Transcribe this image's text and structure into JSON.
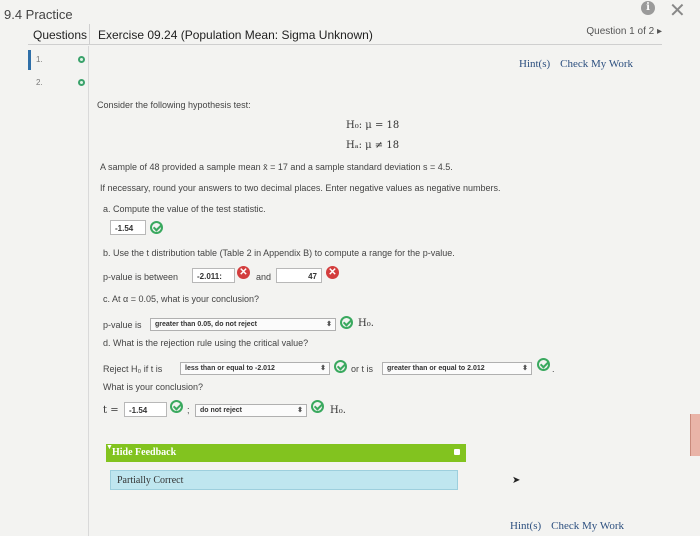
{
  "app": {
    "title": "9.4 Practice"
  },
  "header": {
    "questions_tab": "Questions",
    "exercise_title": "Exercise 09.24 (Population Mean: Sigma Unknown)",
    "counter": "Question 1 of 2 ▸"
  },
  "question_list": [
    {
      "number": "1.",
      "status": "answered"
    },
    {
      "number": "2.",
      "status": "answered"
    }
  ],
  "links": {
    "hints": "Hint(s)",
    "check": "Check My Work"
  },
  "problem": {
    "intro": "Consider the following hypothesis test:",
    "h0": "H₀: μ = 18",
    "ha": "Hₐ: μ ≠ 18",
    "given": "A sample of 48 provided a sample mean x̄ = 17 and a sample standard deviation s = 4.5.",
    "instructions": "If necessary, round your answers to two decimal places. Enter negative values as negative numbers.",
    "part_a_label": "a. Compute the value of the test statistic.",
    "part_a_answer": "-1.54",
    "part_b_label": "b. Use the t distribution table (Table 2 in Appendix B) to compute a range for the p-value.",
    "pvalue_between": "p-value is between",
    "pvalue_low": "-2.011:",
    "and": "and",
    "pvalue_high": "47",
    "part_c_label": "c. At α = 0.05, what is your conclusion?",
    "pvalue_is": "p-value is",
    "pvalue_select": "greater than 0.05, do not reject",
    "h0_end": "H₀.",
    "part_d_label": "d. What is the rejection rule using the critical value?",
    "reject_if": "Reject H₀ if t is",
    "reject_select_1": "less than or equal to -2.012",
    "or_t_is": "or t is",
    "reject_select_2": "greater than or equal to 2.012",
    "period": ".",
    "conclusion_q": "What is your conclusion?",
    "t_eq": "t =",
    "t_value": "-1.54",
    "semicolon": ";",
    "conclusion_select": "do not reject",
    "h0_end2": "H₀."
  },
  "feedback": {
    "toggle_label": "Hide Feedback",
    "result": "Partially Correct"
  },
  "icons": {
    "info": "i",
    "close": "✕",
    "dropdown": "⬍"
  }
}
